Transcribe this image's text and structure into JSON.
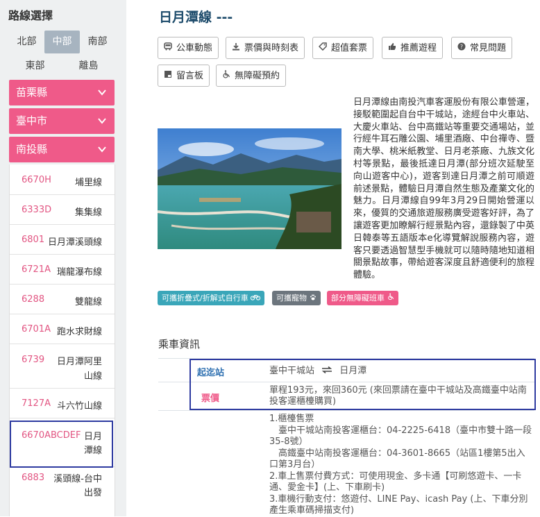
{
  "sidebar": {
    "title": "路線選擇",
    "regions": [
      "北部",
      "中部",
      "南部",
      "東部",
      "離島"
    ],
    "active_region": "中部",
    "counties": [
      {
        "label": "苗栗縣",
        "icon": "chevron-down-icon"
      },
      {
        "label": "臺中市",
        "icon": "chevron-down-icon"
      },
      {
        "label": "南投縣",
        "icon": "chevron-down-icon"
      }
    ],
    "routes": [
      {
        "code": "6670H",
        "name": "埔里線"
      },
      {
        "code": "6333D",
        "name": "集集線"
      },
      {
        "code": "6801",
        "name": "日月潭溪頭線"
      },
      {
        "code": "6721A",
        "name": "瑞龍瀑布線"
      },
      {
        "code": "6288",
        "name": "雙龍線"
      },
      {
        "code": "6701A",
        "name": "跑水求財線"
      },
      {
        "code": "6739",
        "name": "日月潭阿里山線"
      },
      {
        "code": "7127A",
        "name": "斗六竹山線"
      },
      {
        "code": "6670ABCDEF",
        "name": "日月潭線"
      },
      {
        "code": "6883",
        "name": "溪頭線-台中出發"
      }
    ]
  },
  "main": {
    "title": "日月潭線 ---",
    "buttons": [
      {
        "label": "公車動態",
        "icon": "bus-icon"
      },
      {
        "label": "票價與時刻表",
        "icon": "download-icon"
      },
      {
        "label": "超值套票",
        "icon": "tag-icon"
      },
      {
        "label": "推薦遊程",
        "icon": "thumbs-up-icon"
      },
      {
        "label": "常見問題",
        "icon": "question-icon"
      },
      {
        "label": "留言板",
        "icon": "message-icon"
      },
      {
        "label": "無障礙預約",
        "icon": "wheelchair-icon"
      }
    ],
    "description": "日月潭線由南投汽車客運股份有限公車營運，接駁範圍起自台中干城站，途經台中火車站、大慶火車站、台中高鐵站等重要交通場站，並行經牛耳石雕公園、埔里酒廠、中台禪寺、暨南大學、桃米紙教堂、日月老茶廠、九族文化村等景點，最後抵達日月潭(部分班次延駛至向山遊客中心)，遊客到達日月潭之前可順遊前述景點，體驗日月潭自然生態及產業文化的魅力。日月潭線自99年3月29日開始營運以來，優質的交通旅遊服務廣受遊客好評，為了讓遊客更加瞭解行經景點內容，還錄製了中英日韓泰等五語版本e化導覽解說服務內容，遊客只要透過智慧型手機就可以隨時隨地知道相關景點故事，帶給遊客深度且舒適便利的旅程體驗。",
    "tags": [
      {
        "label": "可攜折疊式/折解式自行車",
        "icon": "bicycle-icon",
        "color": "#3aa6b9"
      },
      {
        "label": "可攜寵物",
        "icon": "paw-icon",
        "color": "#6c757d"
      },
      {
        "label": "部分無障礙班車",
        "icon": "wheelchair-icon",
        "color": "#ef5a89"
      }
    ],
    "section_title": "乘車資訊",
    "info": {
      "route_label": "起迄站",
      "route_from": "臺中干城站",
      "route_to": "日月潭",
      "swap_icon": "swap-arrows-icon",
      "fare_label": "票價",
      "fare_value": "單程193元，來回360元 (來回票請在臺中干城站及高鐵臺中站南投客運櫃檯購買)",
      "ticket_lines": [
        "1.櫃檯售票",
        "　臺中干城站南投客運櫃台：04-2225-6418（臺中市雙十路一段35-8號）",
        "　高鐵臺中站南投客運櫃台：04-3601-8665（站區1樓第5出入口第3月台）",
        "2.車上售票付費方式：可使用現金、多卡通【可刷悠遊卡、一卡通、愛金卡】(上、下車刷卡)",
        "3.車機行動支付：悠遊付、LINE Pay、icash Pay (上、下車分別產生乘車碼掃描支付)"
      ]
    },
    "colors": {
      "accent": "#ef5a89",
      "title": "#1d4b6b",
      "info_label": "#2d6fb0",
      "highlight_border": "#2d3aa0"
    }
  }
}
